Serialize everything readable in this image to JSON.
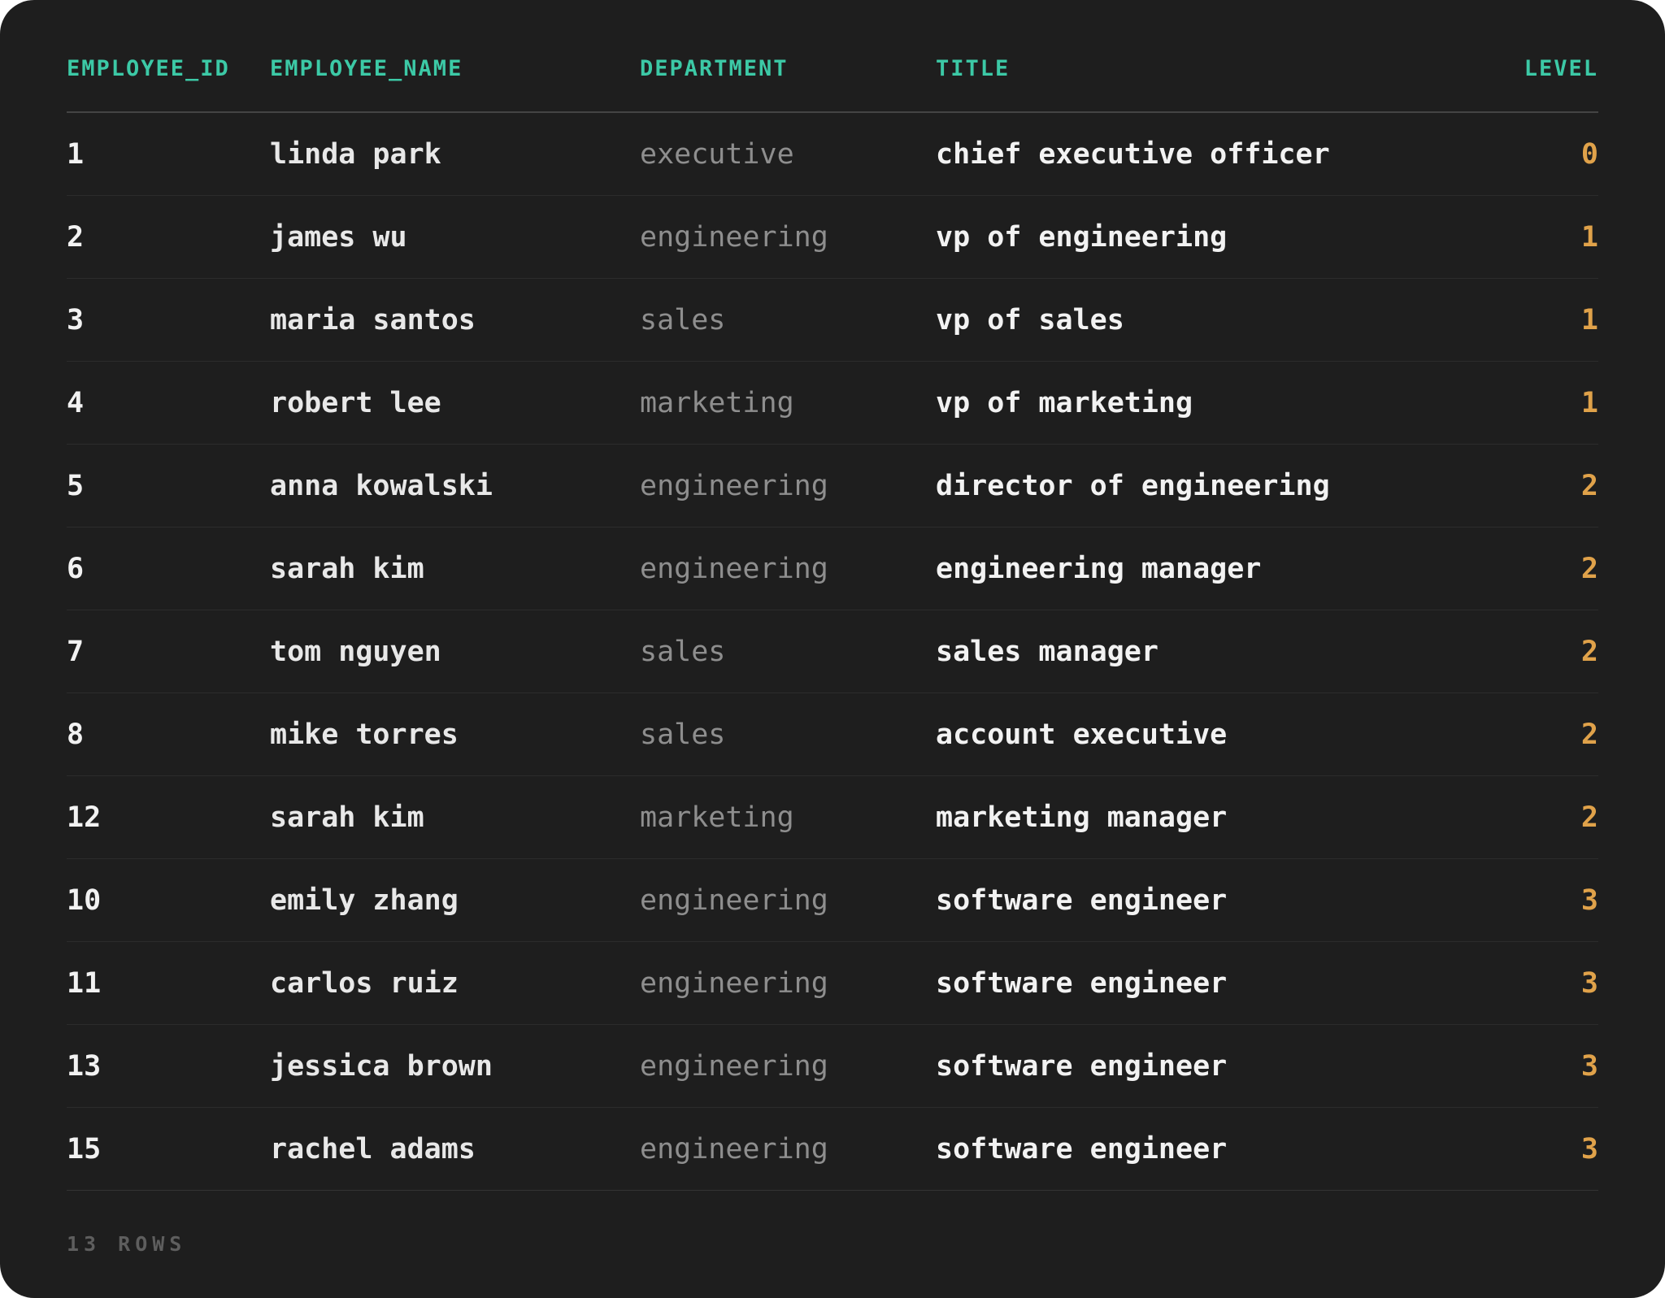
{
  "table": {
    "columns": [
      "EMPLOYEE_ID",
      "EMPLOYEE_NAME",
      "DEPARTMENT",
      "TITLE",
      "LEVEL"
    ],
    "rows": [
      {
        "employee_id": "1",
        "employee_name": "linda park",
        "department": "executive",
        "title": "chief executive officer",
        "level": "0"
      },
      {
        "employee_id": "2",
        "employee_name": "james wu",
        "department": "engineering",
        "title": "vp of engineering",
        "level": "1"
      },
      {
        "employee_id": "3",
        "employee_name": "maria santos",
        "department": "sales",
        "title": "vp of sales",
        "level": "1"
      },
      {
        "employee_id": "4",
        "employee_name": "robert lee",
        "department": "marketing",
        "title": "vp of marketing",
        "level": "1"
      },
      {
        "employee_id": "5",
        "employee_name": "anna kowalski",
        "department": "engineering",
        "title": "director of engineering",
        "level": "2"
      },
      {
        "employee_id": "6",
        "employee_name": "sarah kim",
        "department": "engineering",
        "title": "engineering manager",
        "level": "2"
      },
      {
        "employee_id": "7",
        "employee_name": "tom nguyen",
        "department": "sales",
        "title": "sales manager",
        "level": "2"
      },
      {
        "employee_id": "8",
        "employee_name": "mike torres",
        "department": "sales",
        "title": "account executive",
        "level": "2"
      },
      {
        "employee_id": "12",
        "employee_name": "sarah kim",
        "department": "marketing",
        "title": "marketing manager",
        "level": "2"
      },
      {
        "employee_id": "10",
        "employee_name": "emily zhang",
        "department": "engineering",
        "title": "software engineer",
        "level": "3"
      },
      {
        "employee_id": "11",
        "employee_name": "carlos ruiz",
        "department": "engineering",
        "title": "software engineer",
        "level": "3"
      },
      {
        "employee_id": "13",
        "employee_name": "jessica brown",
        "department": "engineering",
        "title": "software engineer",
        "level": "3"
      },
      {
        "employee_id": "15",
        "employee_name": "rachel adams",
        "department": "engineering",
        "title": "software engineer",
        "level": "3"
      }
    ]
  },
  "footer": {
    "row_count": "13 ROWS"
  },
  "colors": {
    "background": "#1e1e1e",
    "header_text": "#3cc9a6",
    "level_text": "#e0a24a",
    "department_text": "#8e8e8e",
    "primary_text": "#f2f2f2",
    "footer_text": "#5e5e5e"
  }
}
